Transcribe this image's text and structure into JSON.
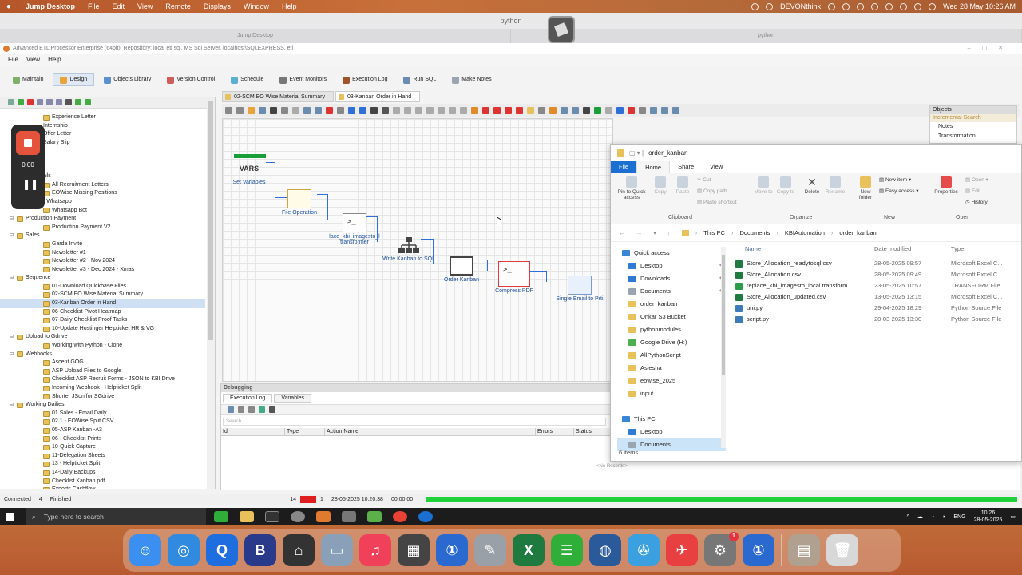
{
  "mac_menubar": {
    "app": "Jump Desktop",
    "items": [
      "File",
      "Edit",
      "View",
      "Remote",
      "Displays",
      "Window",
      "Help"
    ],
    "tray_app": "DEVONthink",
    "datetime": "Wed 28 May  10:26 AM"
  },
  "jump_desktop": {
    "window_title": "python",
    "tabs": [
      "Jump Desktop",
      "python"
    ]
  },
  "etl_app": {
    "title": "Advanced ETL Processor Enterprise (64bit), Repository: local etl sql, MS Sql Server, localhost\\SQLEXPRESS, etl",
    "menu": [
      "File",
      "View",
      "Help"
    ],
    "main_tabs": [
      "Maintain",
      "Design",
      "Objects Library",
      "Version Control",
      "Schedule",
      "Event Monitors",
      "Execution Log",
      "Run SQL",
      "Make Notes"
    ],
    "editor_tabs": [
      "02-SCM EO Wise Material Summary",
      "03-Kanban Order in Hand"
    ],
    "nodes": {
      "set_variables": "Set Variables",
      "vars": "VARS",
      "file_operation": "File Operation",
      "replace": "lace_kbi_imagesto_l transformer",
      "write": "Write Kanban to SQL",
      "order_kanban": "Order Kanban",
      "compress": "Compress PDF",
      "email": "Single Email to Prti"
    },
    "objects_panel": {
      "header": "Objects",
      "search": "Incremental Search",
      "items": [
        "Notes",
        "Transformation"
      ]
    },
    "debugging": {
      "header": "Debugging",
      "tabs": [
        "Execution Log",
        "Variables"
      ],
      "search": "Search",
      "columns": [
        "Id",
        "Type",
        "Action Name",
        "Errors",
        "Status"
      ],
      "empty": "<No Records>"
    },
    "status": {
      "connected": "Connected",
      "count": "4",
      "state": "Finished",
      "n1": "14",
      "n2": "1",
      "datetime": "28-05-2025 10:20:38",
      "elapsed": "00:00:00"
    }
  },
  "tree": [
    {
      "label": "Experience Letter",
      "level": 3,
      "folder": true
    },
    {
      "label": "Internship",
      "level": 3,
      "folder": false
    },
    {
      "label": "Offer Letter",
      "level": 3,
      "folder": false
    },
    {
      "label": "Salary Slip",
      "level": 3,
      "folder": false
    },
    {
      "label": "Templates",
      "level": 1,
      "folder": false
    },
    {
      "label": "Read",
      "level": 1,
      "folder": false
    },
    {
      "label": "ages",
      "level": 1,
      "folder": false
    },
    {
      "label": "HTML Emails",
      "level": 1,
      "folder": false
    },
    {
      "label": "All Recruitment Letters",
      "level": 3,
      "folder": true
    },
    {
      "label": "EOWise Missing Positions",
      "level": 3,
      "folder": true
    },
    {
      "label": "Meeplecon Whatsapp",
      "level": 1,
      "folder": false
    },
    {
      "label": "Whatsapp Bot",
      "level": 3,
      "folder": true
    },
    {
      "label": "Production Payment",
      "level": 1,
      "folder": true,
      "toggle": "⊟"
    },
    {
      "label": "Production Payment V2",
      "level": 3,
      "folder": true
    },
    {
      "label": "Sales",
      "level": 1,
      "folder": true,
      "toggle": "⊟"
    },
    {
      "label": "Garda Invite",
      "level": 3,
      "folder": true
    },
    {
      "label": "Newsletter #1",
      "level": 3,
      "folder": true
    },
    {
      "label": "Newsletter #2 - Nov 2024",
      "level": 3,
      "folder": true
    },
    {
      "label": "Newsletter #3 - Dec 2024 - Xmas",
      "level": 3,
      "folder": true
    },
    {
      "label": "Sequence",
      "level": 1,
      "folder": true,
      "toggle": "⊟"
    },
    {
      "label": "01-Download Quickbase Files",
      "level": 3,
      "folder": true
    },
    {
      "label": "02-SCM EO Wise Material Summary",
      "level": 3,
      "folder": true
    },
    {
      "label": "03-Kanban Order in Hand",
      "level": 3,
      "folder": true,
      "selected": true
    },
    {
      "label": "06-Checklist Pivot Heatmap",
      "level": 3,
      "folder": true
    },
    {
      "label": "07-Daily Checklist Proof Tasks",
      "level": 3,
      "folder": true
    },
    {
      "label": "10-Update Hostinger Helpticket HR & VG",
      "level": 3,
      "folder": true
    },
    {
      "label": "Upload to Gdrive",
      "level": 1,
      "folder": true,
      "toggle": "⊟"
    },
    {
      "label": "Working with Python - Clone",
      "level": 3,
      "folder": true
    },
    {
      "label": "Webhooks",
      "level": 1,
      "folder": true,
      "toggle": "⊟"
    },
    {
      "label": "Ascent GOG",
      "level": 3,
      "folder": true
    },
    {
      "label": "ASP Upload Files to Google",
      "level": 3,
      "folder": true
    },
    {
      "label": "Checklist ASP Recruit Forms - JSON to KBI Drive",
      "level": 3,
      "folder": true
    },
    {
      "label": "Incoming Webhook - Helpticket Split",
      "level": 3,
      "folder": true
    },
    {
      "label": "Shorter JSon for SGdrive",
      "level": 3,
      "folder": true
    },
    {
      "label": "Working Dailies",
      "level": 1,
      "folder": true,
      "toggle": "⊟"
    },
    {
      "label": "01 Sales - Email Daily",
      "level": 3,
      "folder": true
    },
    {
      "label": "02.1 - EOWise Split CSV",
      "level": 3,
      "folder": true
    },
    {
      "label": "05-ASP Kanban -A3",
      "level": 3,
      "folder": true
    },
    {
      "label": "06 - Checklist Prints",
      "level": 3,
      "folder": true
    },
    {
      "label": "10-Quick Capture",
      "level": 3,
      "folder": true
    },
    {
      "label": "11-Delegation Sheets",
      "level": 3,
      "folder": true
    },
    {
      "label": "13 - Helpticket Split",
      "level": 3,
      "folder": true
    },
    {
      "label": "14-Daily Backups",
      "level": 3,
      "folder": true
    },
    {
      "label": "Checklist Kanban pdf",
      "level": 3,
      "folder": true
    },
    {
      "label": "Exports Cashflow",
      "level": 3,
      "folder": true
    }
  ],
  "recorder": {
    "time": "0:00"
  },
  "explorer": {
    "title": "order_kanban",
    "tabs": [
      "File",
      "Home",
      "Share",
      "View"
    ],
    "ribbon": {
      "pin": "Pin to Quick access",
      "copy": "Copy",
      "paste": "Paste",
      "cut": "Cut",
      "copy_path": "Copy path",
      "paste_shortcut": "Paste shortcut",
      "move_to": "Move to",
      "copy_to": "Copy to",
      "delete": "Delete",
      "rename": "Rename",
      "new_folder": "New folder",
      "new_item": "New item",
      "easy_access": "Easy access",
      "properties": "Properties",
      "open": "Open",
      "edit": "Edit",
      "history": "History",
      "groups": [
        "Clipboard",
        "Organize",
        "New",
        "Open"
      ]
    },
    "breadcrumb": [
      "This PC",
      "Documents",
      "KBIAutomation",
      "order_kanban"
    ],
    "nav": [
      {
        "label": "Quick access",
        "type": "head",
        "color": "#3a86d6"
      },
      {
        "label": "Desktop",
        "type": "item",
        "pin": true,
        "color": "#2f7bd3"
      },
      {
        "label": "Downloads",
        "type": "item",
        "pin": true,
        "color": "#2f7bd3"
      },
      {
        "label": "Documents",
        "type": "item",
        "pin": true,
        "color": "#9aa5b1"
      },
      {
        "label": "order_kanban",
        "type": "item",
        "color": "#e8c15a"
      },
      {
        "label": "Onkar S3 Bucket",
        "type": "item",
        "color": "#e8c15a"
      },
      {
        "label": "pythonmodules",
        "type": "item",
        "color": "#e8c15a"
      },
      {
        "label": "Google Drive (H:)",
        "type": "item",
        "color": "#4caf50"
      },
      {
        "label": "AllPythonScript",
        "type": "item",
        "color": "#e8c15a"
      },
      {
        "label": "Aslesha",
        "type": "item",
        "color": "#e8c15a"
      },
      {
        "label": "eowise_2025",
        "type": "item",
        "color": "#e8c15a"
      },
      {
        "label": "input",
        "type": "item",
        "color": "#e8c15a"
      },
      {
        "label": "",
        "type": "spacer",
        "color": ""
      },
      {
        "label": "This PC",
        "type": "head",
        "color": "#3a86d6"
      },
      {
        "label": "Desktop",
        "type": "item",
        "color": "#2f7bd3"
      },
      {
        "label": "Documents",
        "type": "item",
        "selected": true,
        "color": "#9aa5b1"
      }
    ],
    "columns": [
      "Name",
      "Date modified",
      "Type",
      "S"
    ],
    "files": [
      {
        "name": "Store_Allocation_readytosql.csv",
        "date": "28-05-2025 09:57",
        "type": "Microsoft Excel C...",
        "color": "#1f7a3f"
      },
      {
        "name": "Store_Allocation.csv",
        "date": "28-05-2025 09:49",
        "type": "Microsoft Excel C...",
        "color": "#1f7a3f"
      },
      {
        "name": "replace_kbi_imagesto_local.transform",
        "date": "23-05-2025 10:57",
        "type": "TRANSFORM File",
        "color": "#2a9d4a"
      },
      {
        "name": "Store_Allocation_updated.csv",
        "date": "13-05-2025 13:15",
        "type": "Microsoft Excel C...",
        "color": "#1f7a3f"
      },
      {
        "name": "uni.py",
        "date": "29-04-2025 18:29",
        "type": "Python Source File",
        "color": "#3d7ab8"
      },
      {
        "name": "script.py",
        "date": "20-03-2025 13:30",
        "type": "Python Source File",
        "color": "#3d7ab8"
      }
    ],
    "item_count": "6 items"
  },
  "taskbar": {
    "search_placeholder": "Type here to search",
    "lang": "ENG",
    "time": "10:26",
    "date": "28-05-2025"
  },
  "dock": {
    "apps": [
      {
        "name": "finder-icon",
        "color": "#3b8ff0",
        "glyph": "☺"
      },
      {
        "name": "safari-icon",
        "color": "#2f8ae0",
        "glyph": "◎"
      },
      {
        "name": "q-app-icon",
        "color": "#1f6ee0",
        "glyph": "Q"
      },
      {
        "name": "bbedit-icon",
        "color": "#2a3a8a",
        "glyph": "B"
      },
      {
        "name": "cleaner-icon",
        "color": "#333333",
        "glyph": "⌂"
      },
      {
        "name": "preview-icon",
        "color": "#8aa0b8",
        "glyph": "▭"
      },
      {
        "name": "music-icon",
        "color": "#f0405a",
        "glyph": "♫"
      },
      {
        "name": "calculator-icon",
        "color": "#444444",
        "glyph": "▦"
      },
      {
        "name": "onepassword-icon",
        "color": "#2a6ad0",
        "glyph": "①"
      },
      {
        "name": "script-editor-icon",
        "color": "#9aa0a8",
        "glyph": "✎"
      },
      {
        "name": "excel-icon",
        "color": "#1f7a3f",
        "glyph": "X"
      },
      {
        "name": "sheets-app-icon",
        "color": "#2fae3a",
        "glyph": "☰"
      },
      {
        "name": "proxyman-icon",
        "color": "#2a5a9a",
        "glyph": "◍"
      },
      {
        "name": "vpn-icon",
        "color": "#3aa0e0",
        "glyph": "✇"
      },
      {
        "name": "sketch-icon",
        "color": "#e84040",
        "glyph": "✈"
      },
      {
        "name": "system-settings-icon",
        "color": "#777777",
        "glyph": "⚙",
        "badge": "1"
      },
      {
        "name": "onepassword-mini-icon",
        "color": "#2a6ad0",
        "glyph": "①"
      },
      {
        "name": "photos-stack-icon",
        "color": "#b0a090",
        "glyph": "▤"
      },
      {
        "name": "trash-icon",
        "color": "#d8d8d8",
        "glyph": "🗑"
      }
    ]
  }
}
